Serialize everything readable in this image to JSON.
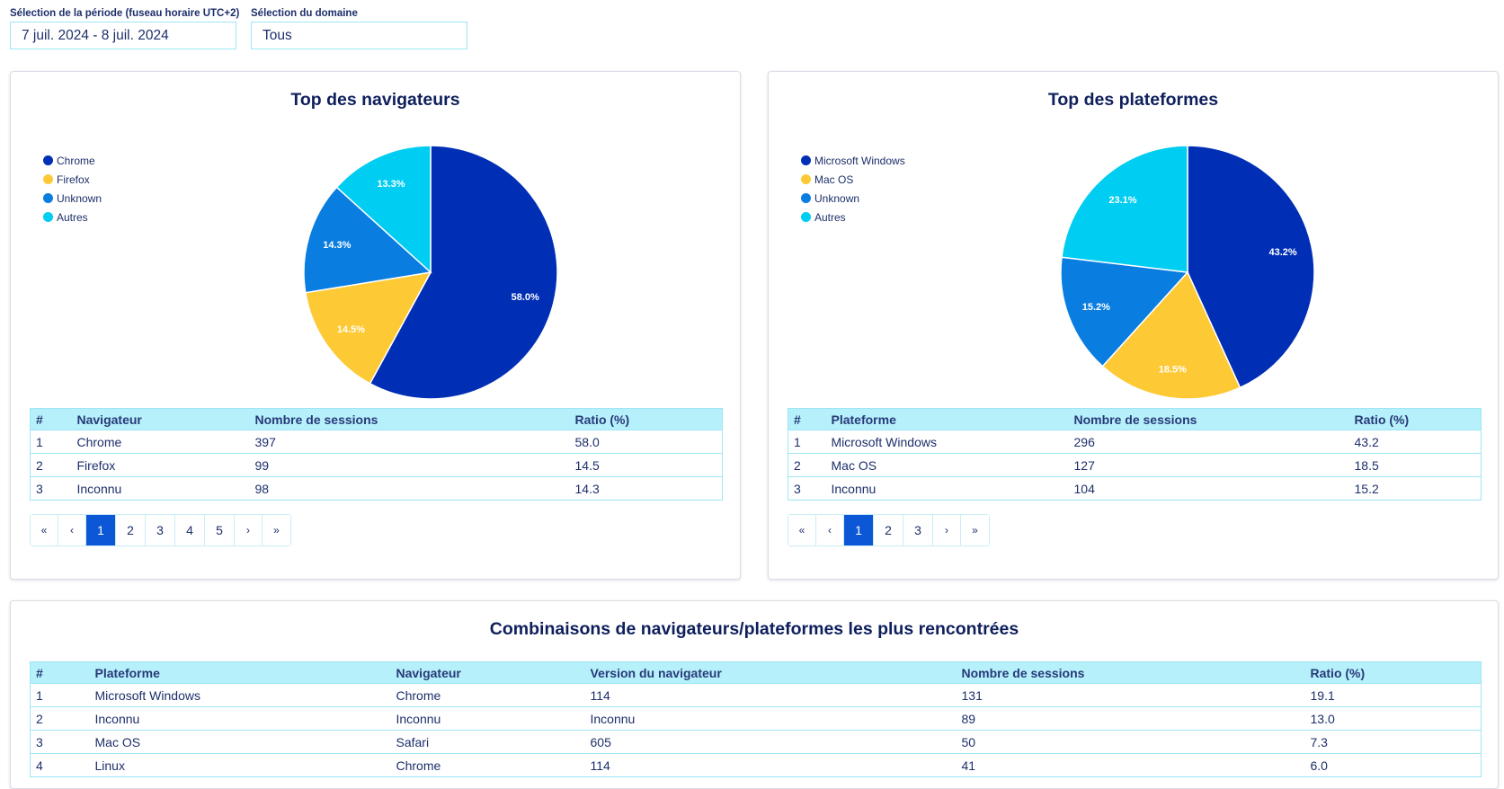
{
  "filters": {
    "period_label": "Sélection de la période (fuseau horaire UTC+2)",
    "period_value": "7 juil. 2024 - 8 juil. 2024",
    "domain_label": "Sélection du domaine",
    "domain_value": "Tous"
  },
  "colors": {
    "dark_blue": "#002fb5",
    "yellow": "#fdc935",
    "mid_blue": "#0a7de0",
    "cyan": "#00cdf2",
    "table_header": "#b6f0fb",
    "pager_active": "#0b57d6"
  },
  "browsers": {
    "title": "Top des navigateurs",
    "legend": [
      "Chrome",
      "Firefox",
      "Unknown",
      "Autres"
    ],
    "table": {
      "headers": [
        "#",
        "Navigateur",
        "Nombre de sessions",
        "Ratio (%)"
      ],
      "rows": [
        [
          "1",
          "Chrome",
          "397",
          "58.0"
        ],
        [
          "2",
          "Firefox",
          "99",
          "14.5"
        ],
        [
          "3",
          "Inconnu",
          "98",
          "14.3"
        ]
      ]
    },
    "pagination": [
      "«",
      "‹",
      "1",
      "2",
      "3",
      "4",
      "5",
      "›",
      "»"
    ],
    "active_page": "1"
  },
  "platforms": {
    "title": "Top des plateformes",
    "legend": [
      "Microsoft Windows",
      "Mac OS",
      "Unknown",
      "Autres"
    ],
    "table": {
      "headers": [
        "#",
        "Plateforme",
        "Nombre de sessions",
        "Ratio (%)"
      ],
      "rows": [
        [
          "1",
          "Microsoft Windows",
          "296",
          "43.2"
        ],
        [
          "2",
          "Mac OS",
          "127",
          "18.5"
        ],
        [
          "3",
          "Inconnu",
          "104",
          "15.2"
        ]
      ]
    },
    "pagination": [
      "«",
      "‹",
      "1",
      "2",
      "3",
      "›",
      "»"
    ],
    "active_page": "1"
  },
  "combinations": {
    "title": "Combinaisons de navigateurs/plateformes les plus rencontrées",
    "table": {
      "headers": [
        "#",
        "Plateforme",
        "Navigateur",
        "Version du navigateur",
        "Nombre de sessions",
        "Ratio (%)"
      ],
      "rows": [
        [
          "1",
          "Microsoft Windows",
          "Chrome",
          "114",
          "131",
          "19.1"
        ],
        [
          "2",
          "Inconnu",
          "Inconnu",
          "Inconnu",
          "89",
          "13.0"
        ],
        [
          "3",
          "Mac OS",
          "Safari",
          "605",
          "50",
          "7.3"
        ],
        [
          "4",
          "Linux",
          "Chrome",
          "114",
          "41",
          "6.0"
        ]
      ]
    }
  },
  "chart_data": [
    {
      "type": "pie",
      "title": "Top des navigateurs",
      "categories": [
        "Chrome",
        "Firefox",
        "Unknown",
        "Autres"
      ],
      "values": [
        58.0,
        14.5,
        14.3,
        13.3
      ],
      "labels": [
        "58.0%",
        "14.5%",
        "14.3%",
        "13.3%"
      ],
      "colors": [
        "#002fb5",
        "#fdc935",
        "#0a7de0",
        "#00cdf2"
      ],
      "legend": "top-left"
    },
    {
      "type": "pie",
      "title": "Top des plateformes",
      "categories": [
        "Microsoft Windows",
        "Mac OS",
        "Unknown",
        "Autres"
      ],
      "values": [
        43.2,
        18.5,
        15.2,
        23.1
      ],
      "labels": [
        "43.2%",
        "18.5%",
        "15.2%",
        "23.1%"
      ],
      "colors": [
        "#002fb5",
        "#fdc935",
        "#0a7de0",
        "#00cdf2"
      ],
      "legend": "top-left"
    }
  ]
}
